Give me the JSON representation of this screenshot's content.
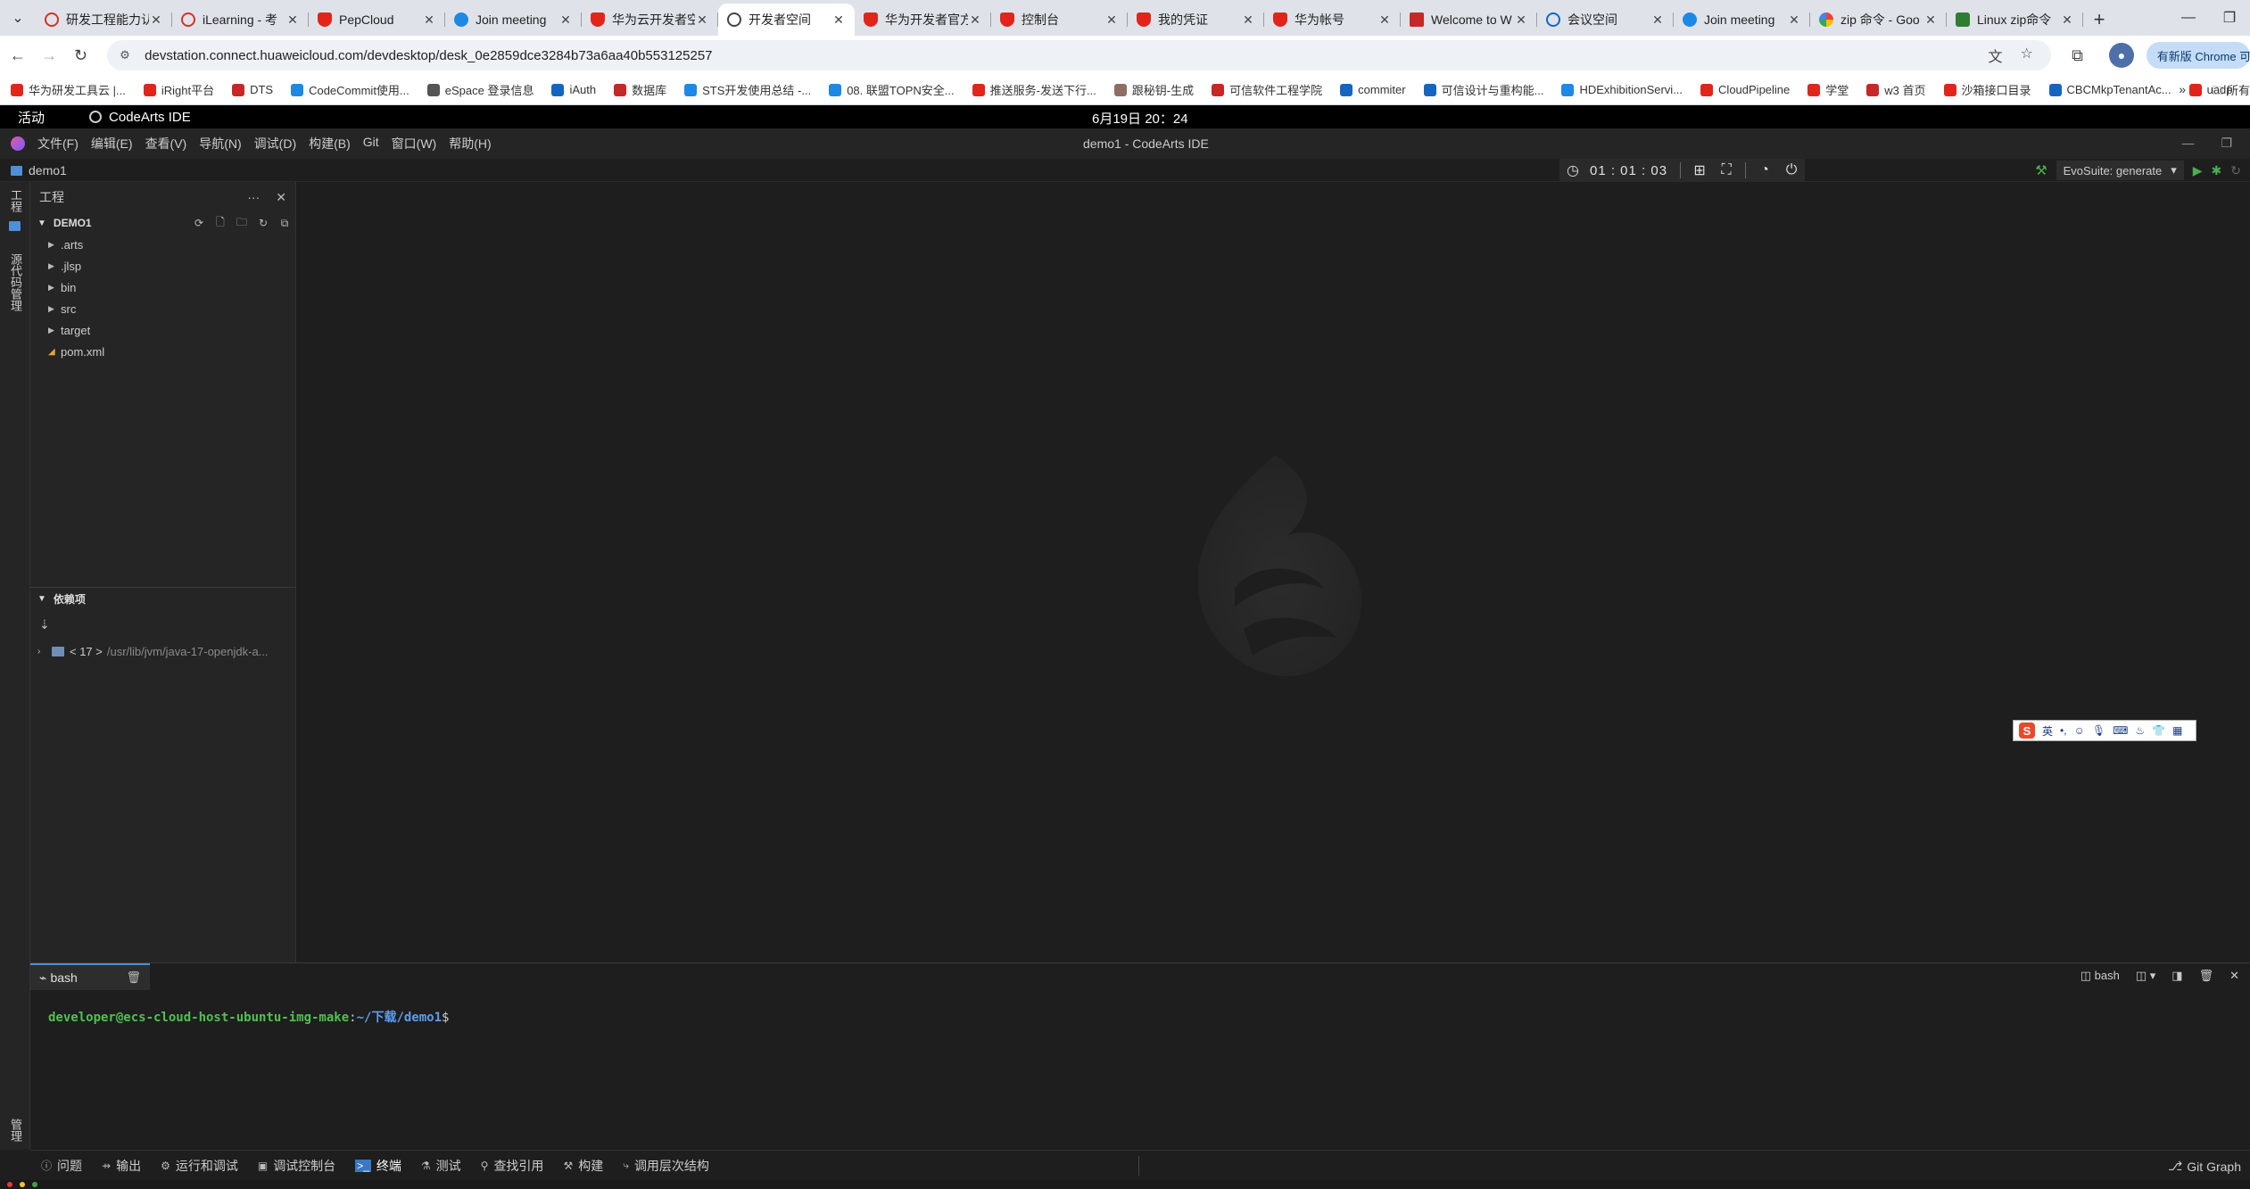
{
  "browser": {
    "tabs": [
      {
        "title": "研发工程能力认",
        "favicon": "fav-red-ring"
      },
      {
        "title": "iLearning - 考",
        "favicon": "fav-red-ring"
      },
      {
        "title": "PepCloud",
        "favicon": "fav-hw"
      },
      {
        "title": "Join meeting",
        "favicon": "fav-blue"
      },
      {
        "title": "华为云开发者空",
        "favicon": "fav-hw"
      },
      {
        "title": "开发者空间",
        "favicon": "fav-globe"
      },
      {
        "title": "华为开发者官方",
        "favicon": "fav-hw"
      },
      {
        "title": "控制台",
        "favicon": "fav-hw"
      },
      {
        "title": "我的凭证",
        "favicon": "fav-hw"
      },
      {
        "title": "华为帐号",
        "favicon": "fav-hw"
      },
      {
        "title": "Welcome to W",
        "favicon": "fav-w3"
      },
      {
        "title": "会议空间",
        "favicon": "fav-globe2"
      },
      {
        "title": "Join meeting",
        "favicon": "fav-blue"
      },
      {
        "title": "zip 命令 - Goo",
        "favicon": "fav-g"
      },
      {
        "title": "Linux zip命令",
        "favicon": "fav-green"
      }
    ],
    "active_tab_index": 5,
    "url": "devstation.connect.huaweicloud.com/devdesktop/desk_0e2859dce3284b73a6aa40b553125257",
    "update_label": "有新版 Chrome 可用",
    "bookmarks": [
      {
        "label": "华为研发工具云 |...",
        "color": "#e1251b"
      },
      {
        "label": "iRight平台",
        "color": "#e1251b"
      },
      {
        "label": "DTS",
        "color": "#c62828"
      },
      {
        "label": "CodeCommit使用...",
        "color": "#1e88e5"
      },
      {
        "label": "eSpace 登录信息",
        "color": "#555555"
      },
      {
        "label": "iAuth",
        "color": "#1565c0"
      },
      {
        "label": "数据库",
        "color": "#c62828"
      },
      {
        "label": "STS开发使用总结 -...",
        "color": "#1e88e5"
      },
      {
        "label": "08. 联盟TOPN安全...",
        "color": "#1e88e5"
      },
      {
        "label": "推送服务-发送下行...",
        "color": "#e1251b"
      },
      {
        "label": "跟秘钥-生成",
        "color": "#8d6e63"
      },
      {
        "label": "可信软件工程学院",
        "color": "#c62828"
      },
      {
        "label": "commiter",
        "color": "#1565c0"
      },
      {
        "label": "可信设计与重构能...",
        "color": "#1565c0"
      },
      {
        "label": "HDExhibitionServi...",
        "color": "#1e88e5"
      },
      {
        "label": "CloudPipeline",
        "color": "#e1251b"
      },
      {
        "label": "学堂",
        "color": "#e1251b"
      },
      {
        "label": "w3 首页",
        "color": "#c62828"
      },
      {
        "label": "沙箱接口目录",
        "color": "#e1251b"
      },
      {
        "label": "CBCMkpTenantAc...",
        "color": "#1565c0"
      },
      {
        "label": "uadp",
        "color": "#e1251b"
      }
    ],
    "bookmarks_more": "»",
    "all_bookmarks": "所有"
  },
  "desktop": {
    "activities": "活动",
    "app_name": "CodeArts IDE",
    "clock": "6月19日  20：24"
  },
  "ide": {
    "window_title": "demo1 - CodeArts IDE",
    "menu": [
      "文件(F)",
      "编辑(E)",
      "查看(V)",
      "导航(N)",
      "调试(D)",
      "构建(B)",
      "Git",
      "窗口(W)",
      "帮助(H)"
    ],
    "breadcrumb": "demo1",
    "timer": "01 : 01 : 03",
    "run_config": "EvoSuite: generate",
    "activity_bar": {
      "project": "工程",
      "vcs": "源代码管理",
      "bottom": "管理"
    },
    "explorer": {
      "title": "工程",
      "project_name": "DEMO1",
      "items": [
        {
          "label": ".arts",
          "type": "folder"
        },
        {
          "label": ".jlsp",
          "type": "folder"
        },
        {
          "label": "bin",
          "type": "folder"
        },
        {
          "label": "src",
          "type": "folder"
        },
        {
          "label": "target",
          "type": "folder"
        },
        {
          "label": "pom.xml",
          "type": "file"
        }
      ],
      "dependencies_title": "依赖项",
      "jdk_label": "< 17 >",
      "jdk_path": "/usr/lib/jvm/java-17-openjdk-a..."
    },
    "panel": {
      "terminal_tab": "bash",
      "right_label": "bash",
      "prompt_user": "developer@ecs-cloud-host-ubuntu-img-make",
      "prompt_sep": ":",
      "prompt_path": "~/下载/demo1",
      "prompt_symbol": "$"
    },
    "statusbar": [
      {
        "label": "问题",
        "icon": "ⓘ",
        "active": false
      },
      {
        "label": "输出",
        "icon": "⇸",
        "active": false
      },
      {
        "label": "运行和调试",
        "icon": "⚙",
        "active": false
      },
      {
        "label": "调试控制台",
        "icon": "▣",
        "active": false
      },
      {
        "label": "终端",
        "icon": ">_",
        "active": true
      },
      {
        "label": "测试",
        "icon": "⚗",
        "active": false
      },
      {
        "label": "查找引用",
        "icon": "⚲",
        "active": false
      },
      {
        "label": "构建",
        "icon": "⚒",
        "active": false
      },
      {
        "label": "调用层次结构",
        "icon": "⤷",
        "active": false
      }
    ],
    "git_graph": "Git Graph"
  },
  "ime": {
    "mode": "英"
  }
}
